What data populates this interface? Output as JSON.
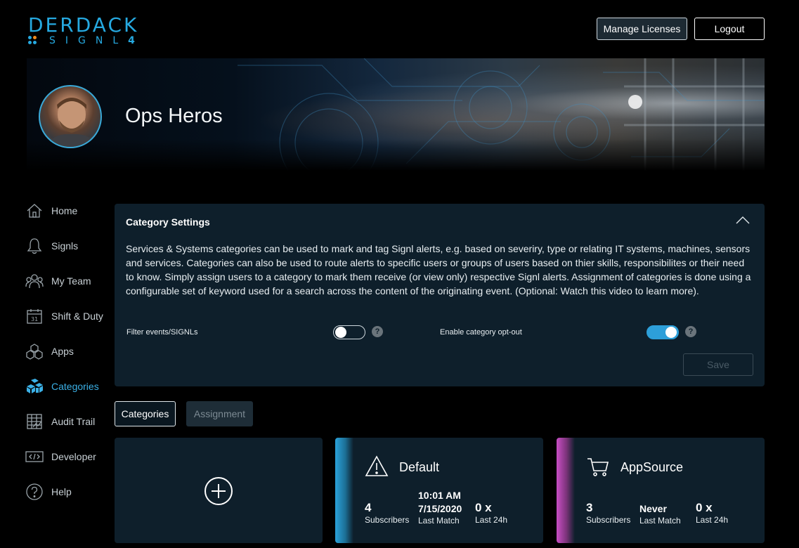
{
  "brand": {
    "wordmark": "DERDACK",
    "product": "SIGNL",
    "version": "4",
    "accent": "#26a9e0"
  },
  "header": {
    "manage_licenses": "Manage Licenses",
    "logout": "Logout"
  },
  "team": {
    "name": "Ops Heros"
  },
  "sidebar": {
    "items": [
      {
        "label": "Home",
        "icon": "home-icon"
      },
      {
        "label": "Signls",
        "icon": "bell-icon"
      },
      {
        "label": "My Team",
        "icon": "team-icon"
      },
      {
        "label": "Shift & Duty",
        "icon": "calendar-icon",
        "calendar_day": "31"
      },
      {
        "label": "Apps",
        "icon": "cubes-icon"
      },
      {
        "label": "Categories",
        "icon": "categories-icon",
        "active": true
      },
      {
        "label": "Audit Trail",
        "icon": "audit-icon"
      },
      {
        "label": "Developer",
        "icon": "code-icon"
      },
      {
        "label": "Help",
        "icon": "help-icon"
      }
    ],
    "active_color": "#3bb0e6"
  },
  "settings": {
    "title": "Category Settings",
    "description": "Services & Systems categories can be used to mark and tag Signl alerts, e.g. based on severiry, type or relating IT systems, machines, sensors and services. Categories can also be used to route alerts to specific users or groups of users based on thier skills, responsibilites or their need to know. Simply assign users to a category to mark them receive (or view only) respective Signl alerts. Assignment of categories is done using a configurable set of keyword used for a search across the content of the originating event. (Optional: Watch this video to learn more).",
    "filter_label": "Filter events/SIGNLs",
    "filter_enabled": false,
    "optout_label": "Enable category opt-out",
    "optout_enabled": true,
    "help_glyph": "?",
    "save_label": "Save"
  },
  "tabs": {
    "categories": "Categories",
    "assignment": "Assignment"
  },
  "cards": [
    {
      "name": "Default",
      "icon": "warning-icon",
      "stripe_color": "#2aa2da",
      "subscribers": "4",
      "subscribers_label": "Subscribers",
      "last_match_time": "10:01 AM",
      "last_match_date": "7/15/2020",
      "last_match_label": "Last Match",
      "last24": "0 x",
      "last24_label": "Last 24h"
    },
    {
      "name": "AppSource",
      "icon": "cart-icon",
      "stripe_color": "#c94fc6",
      "subscribers": "3",
      "subscribers_label": "Subscribers",
      "last_match": "Never",
      "last_match_label": "Last Match",
      "last24": "0 x",
      "last24_label": "Last 24h"
    }
  ]
}
